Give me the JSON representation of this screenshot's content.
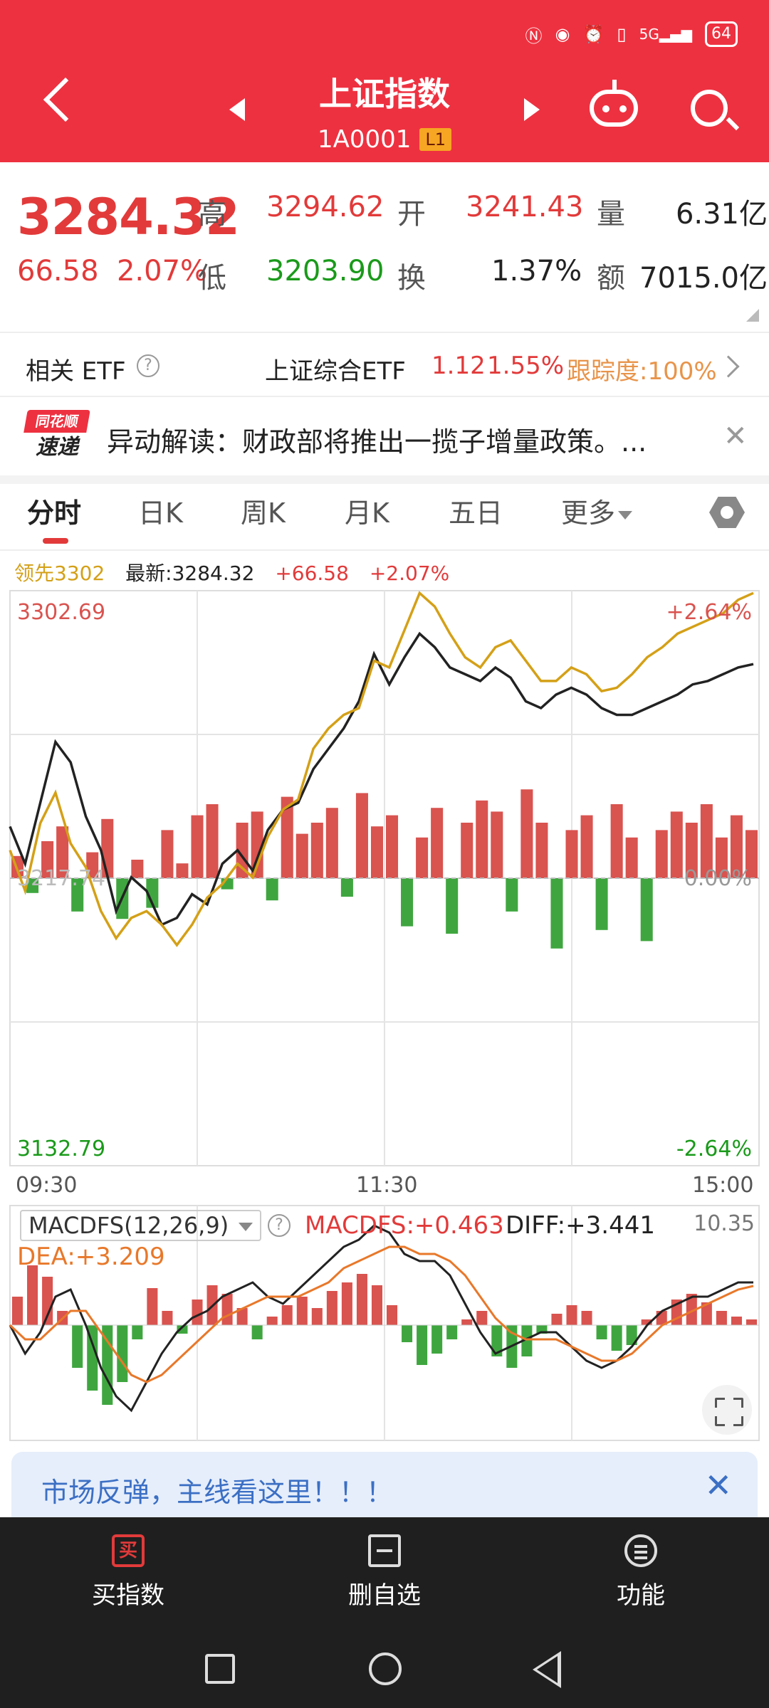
{
  "status_bar": {
    "battery": "64",
    "network": "5G",
    "icons": [
      "nfc-icon",
      "eye-icon",
      "alarm-icon",
      "vibrate-icon",
      "signal-icon",
      "battery-icon"
    ]
  },
  "header": {
    "title": "上证指数",
    "code": "1A0001",
    "level_badge": "L1"
  },
  "quote": {
    "last_price": "3284.32",
    "change": "66.58",
    "change_pct": "2.07%",
    "high_label": "高",
    "high": "3294.62",
    "open_label": "开",
    "open": "3241.43",
    "volume_label": "量",
    "volume": "6.31亿",
    "low_label": "低",
    "low": "3203.90",
    "turnover_label": "换",
    "turnover": "1.37%",
    "amount_label": "额",
    "amount": "7015.0亿"
  },
  "etf": {
    "label": "相关 ETF",
    "help": "?",
    "name": "上证综合ETF",
    "price": "1.12",
    "pct": "1.55%",
    "tracking": "跟踪度:100%"
  },
  "news": {
    "logo_top": "同花顺",
    "logo_bottom": "速递",
    "text": "异动解读：财政部将推出一揽子增量政策。..."
  },
  "tabs": [
    {
      "label": "分时"
    },
    {
      "label": "日K"
    },
    {
      "label": "周K"
    },
    {
      "label": "月K"
    },
    {
      "label": "五日"
    },
    {
      "label": "更多"
    }
  ],
  "legend": {
    "leader": "领先3302",
    "latest": "最新:3284.32",
    "change": "+66.58",
    "pct": "+2.07%"
  },
  "chart_data": {
    "type": "line",
    "y_top_label": "3302.69",
    "y_mid_label": "3217.74",
    "y_bottom_label": "3132.79",
    "pct_top": "+2.64%",
    "pct_mid": "0.00%",
    "pct_bottom": "-2.64%",
    "x_labels": [
      "09:30",
      "11:30",
      "15:00"
    ],
    "ylim": [
      3132.79,
      3302.69
    ],
    "series": [
      {
        "color": "#222222",
        "values": [
          3233,
          3222,
          3240,
          3258,
          3252,
          3236,
          3226,
          3208,
          3218,
          3214,
          3204,
          3206,
          3213,
          3210,
          3222,
          3226,
          3220,
          3232,
          3238,
          3240,
          3250,
          3256,
          3262,
          3270,
          3284,
          3275,
          3283,
          3290,
          3286,
          3280,
          3278,
          3276,
          3280,
          3277,
          3270,
          3268,
          3272,
          3274,
          3272,
          3268,
          3266,
          3266,
          3268,
          3270,
          3272,
          3275,
          3276,
          3278,
          3280,
          3281
        ]
      },
      {
        "color": "#d4a017",
        "values": [
          3226,
          3214,
          3234,
          3243,
          3228,
          3221,
          3208,
          3200,
          3206,
          3208,
          3204,
          3198,
          3204,
          3212,
          3216,
          3222,
          3218,
          3230,
          3238,
          3241,
          3256,
          3262,
          3266,
          3268,
          3282,
          3280,
          3291,
          3302,
          3298,
          3290,
          3283,
          3280,
          3286,
          3288,
          3282,
          3276,
          3276,
          3280,
          3278,
          3273,
          3274,
          3278,
          3283,
          3286,
          3290,
          3292,
          3294,
          3296,
          3300,
          3302
        ]
      }
    ],
    "volume_bars": [
      12,
      -8,
      20,
      28,
      -18,
      14,
      32,
      -22,
      10,
      -16,
      26,
      8,
      34,
      40,
      -6,
      30,
      36,
      -12,
      44,
      24,
      30,
      38,
      -10,
      46,
      28,
      34,
      -26,
      22,
      38,
      -30,
      30,
      42,
      36,
      -18,
      48,
      30,
      -38,
      26,
      34,
      -28,
      40,
      22,
      -34,
      26,
      36,
      30,
      40,
      22,
      34,
      26
    ]
  },
  "macd": {
    "indicator": "MACDFS(12,26,9)",
    "help": "?",
    "macdfs": "MACDFS:+0.463",
    "diff": "DIFF:+3.441",
    "dea": "DEA:+3.209",
    "scale": "10.35",
    "bars": [
      20,
      42,
      34,
      10,
      -30,
      -46,
      -56,
      -40,
      -10,
      26,
      10,
      -6,
      18,
      28,
      22,
      12,
      -10,
      6,
      14,
      20,
      12,
      24,
      30,
      36,
      28,
      14,
      -12,
      -28,
      -20,
      -10,
      4,
      10,
      -22,
      -30,
      -22,
      -6,
      8,
      14,
      10,
      -10,
      -18,
      -14,
      4,
      10,
      18,
      22,
      16,
      10,
      6,
      4
    ]
  },
  "banner": {
    "text": "市场反弹，主线看这里！！！",
    "close": "✕"
  },
  "bottom_bar": {
    "buy_icon": "买",
    "buy": "买指数",
    "remove": "删自选",
    "func": "功能"
  }
}
